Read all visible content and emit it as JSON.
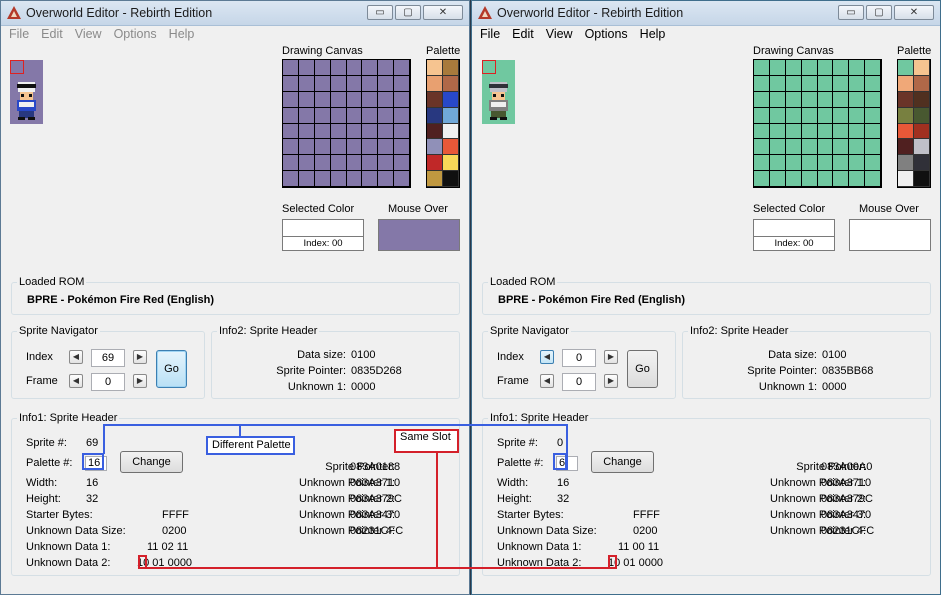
{
  "left": {
    "title": "Overworld Editor - Rebirth Edition",
    "window_buttons": [
      "▭",
      "▢",
      "✕"
    ],
    "menu": [
      "File",
      "Edit",
      "View",
      "Options",
      "Help"
    ],
    "drawing_canvas_label": "Drawing Canvas",
    "palette_label": "Palette",
    "selected_color_label": "Selected Color",
    "index_label": "Index: 00",
    "mouse_over_label": "Mouse Over",
    "loaded_rom_label": "Loaded ROM",
    "rom_name": "BPRE - Pokémon Fire Red (English)",
    "navigator": {
      "title": "Sprite Navigator",
      "index_label": "Index",
      "index_value": "69",
      "frame_label": "Frame",
      "frame_value": "0",
      "go": "Go"
    },
    "info2": {
      "title": "Info2: Sprite Header",
      "labels": [
        "Data size:",
        "Sprite Pointer:",
        "Unknown 1:"
      ],
      "values": [
        "0100",
        "0835D268",
        "0000"
      ]
    },
    "info1": {
      "title": "Info1: Sprite Header",
      "sprite_label": "Sprite #:",
      "sprite_value": "69",
      "palette_label": "Palette #:",
      "palette_value": "16",
      "change": "Change",
      "width_label": "Width:",
      "width_value": "16",
      "height_label": "Height:",
      "height_value": "32",
      "starter_label": "Starter Bytes:",
      "starter_value": "FFFF",
      "uds_label": "Unknown Data Size:",
      "uds_value": "0200",
      "ud1_label": "Unknown Data 1:",
      "ud1_value": "11 02 11",
      "ud2_label": "Unknown Data 2:",
      "ud2_value": "10 01 0000",
      "right_labels": [
        "Sprite Pointer:",
        "Unknown Pointer 1:",
        "Unknown Pointer 2:",
        "Unknown Pointer 3:",
        "Unknown Pointer 4:"
      ],
      "right_values": [
        "083A0188",
        "083A3710",
        "083A379C",
        "083A3470",
        "08231CFC"
      ]
    },
    "colors": {
      "canvas": "#8478a8",
      "mouse_over": "#8478a8",
      "sprite_bg": "#8478a8",
      "palette": [
        "#f6c490",
        "#a87a3c",
        "#e8a070",
        "#b06848",
        "#6a3428",
        "#2848c8",
        "#283880",
        "#70a8d8",
        "#502020",
        "#f0f0f0",
        "#9090b8",
        "#e85838",
        "#c02828",
        "#f8d858",
        "#c09840",
        "#101010"
      ]
    }
  },
  "right": {
    "title": "Overworld Editor - Rebirth Edition",
    "window_buttons": [
      "▭",
      "▢",
      "✕"
    ],
    "menu": [
      "File",
      "Edit",
      "View",
      "Options",
      "Help"
    ],
    "drawing_canvas_label": "Drawing Canvas",
    "palette_label": "Palette",
    "selected_color_label": "Selected Color",
    "index_label": "Index: 00",
    "mouse_over_label": "Mouse Over",
    "loaded_rom_label": "Loaded ROM",
    "rom_name": "BPRE - Pokémon Fire Red (English)",
    "navigator": {
      "title": "Sprite Navigator",
      "index_label": "Index",
      "index_value": "0",
      "frame_label": "Frame",
      "frame_value": "0",
      "go": "Go"
    },
    "info2": {
      "title": "Info2: Sprite Header",
      "labels": [
        "Data size:",
        "Sprite Pointer:",
        "Unknown 1:"
      ],
      "values": [
        "0100",
        "0835BB68",
        "0000"
      ]
    },
    "info1": {
      "title": "Info1: Sprite Header",
      "sprite_label": "Sprite #:",
      "sprite_value": "0",
      "palette_label": "Palette #:",
      "palette_value": "6",
      "change": "Change",
      "width_label": "Width:",
      "width_value": "16",
      "height_label": "Height:",
      "height_value": "32",
      "starter_label": "Starter Bytes:",
      "starter_value": "FFFF",
      "uds_label": "Unknown Data Size:",
      "uds_value": "0200",
      "ud1_label": "Unknown Data 1:",
      "ud1_value": "11 00 11",
      "ud2_label": "Unknown Data 2:",
      "ud2_value": "10 01 0000",
      "right_labels": [
        "Sprite Pointer:",
        "Unknown Pointer 1:",
        "Unknown Pointer 2:",
        "Unknown Pointer 3:",
        "Unknown Pointer 4:"
      ],
      "right_values": [
        "083A00A0",
        "083A3710",
        "083A379C",
        "083A3470",
        "08231CFC"
      ]
    },
    "colors": {
      "canvas": "#70c8a0",
      "mouse_over": "#ffffff",
      "sprite_bg": "#70c8a0",
      "palette": [
        "#70c8a0",
        "#f6c490",
        "#f0a878",
        "#b06848",
        "#6a3428",
        "#503020",
        "#788040",
        "#485830",
        "#e85838",
        "#a03020",
        "#502020",
        "#c0c0c8",
        "#808080",
        "#303038",
        "#f0f0f0",
        "#101010"
      ]
    }
  },
  "annotations": {
    "different_palette": "Different Palette",
    "same_slot": "Same Slot"
  }
}
